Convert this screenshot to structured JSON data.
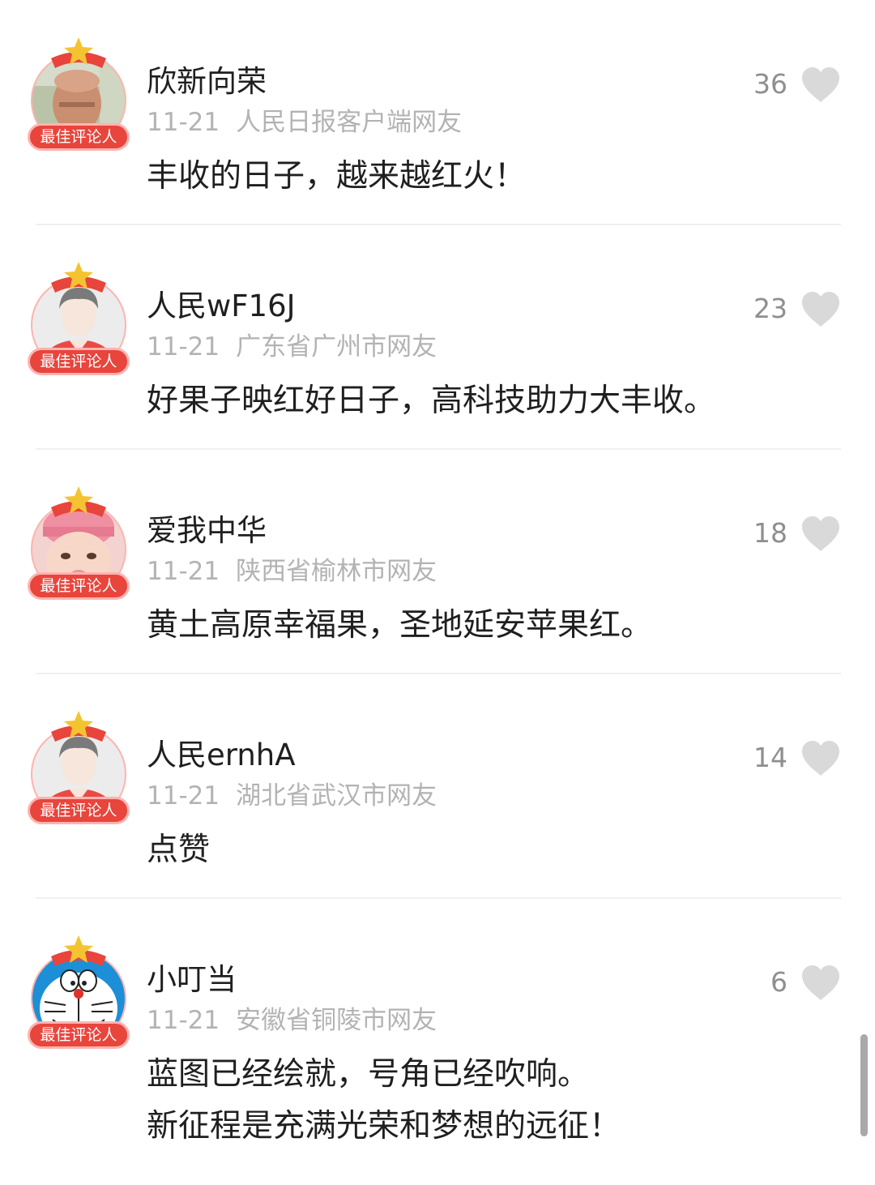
{
  "colors": {
    "badge_red": "#e8453c",
    "badge_pink": "#ffb3b0",
    "star_gold": "#f4c430",
    "like_gray": "#d9d9d9",
    "meta_gray": "#b3b3b3"
  },
  "comments": [
    {
      "username": "欣新向荣",
      "date": "11-21",
      "source": "人民日报客户端网友",
      "lines": [
        "丰收的日子，越来越红火！"
      ],
      "likes": "36",
      "badge": "最佳评论人",
      "avatar": "elderly-man-photo"
    },
    {
      "username": "人民wF16J",
      "date": "11-21",
      "source": "广东省广州市网友",
      "lines": [
        "好果子映红好日子，高科技助力大丰收。"
      ],
      "likes": "23",
      "badge": "最佳评论人",
      "avatar": "default-avatar"
    },
    {
      "username": "爱我中华",
      "date": "11-21",
      "source": "陕西省榆林市网友",
      "lines": [
        "黄土高原幸福果，圣地延安苹果红。"
      ],
      "likes": "18",
      "badge": "最佳评论人",
      "avatar": "baby-photo"
    },
    {
      "username": "人民ernhA",
      "date": "11-21",
      "source": "湖北省武汉市网友",
      "lines": [
        "点赞"
      ],
      "likes": "14",
      "badge": "最佳评论人",
      "avatar": "default-avatar"
    },
    {
      "username": "小叮当",
      "date": "11-21",
      "source": "安徽省铜陵市网友",
      "lines": [
        "蓝图已经绘就，号角已经吹响。",
        "新征程是充满光荣和梦想的远征！"
      ],
      "likes": "6",
      "badge": "最佳评论人",
      "avatar": "doraemon-avatar"
    }
  ]
}
